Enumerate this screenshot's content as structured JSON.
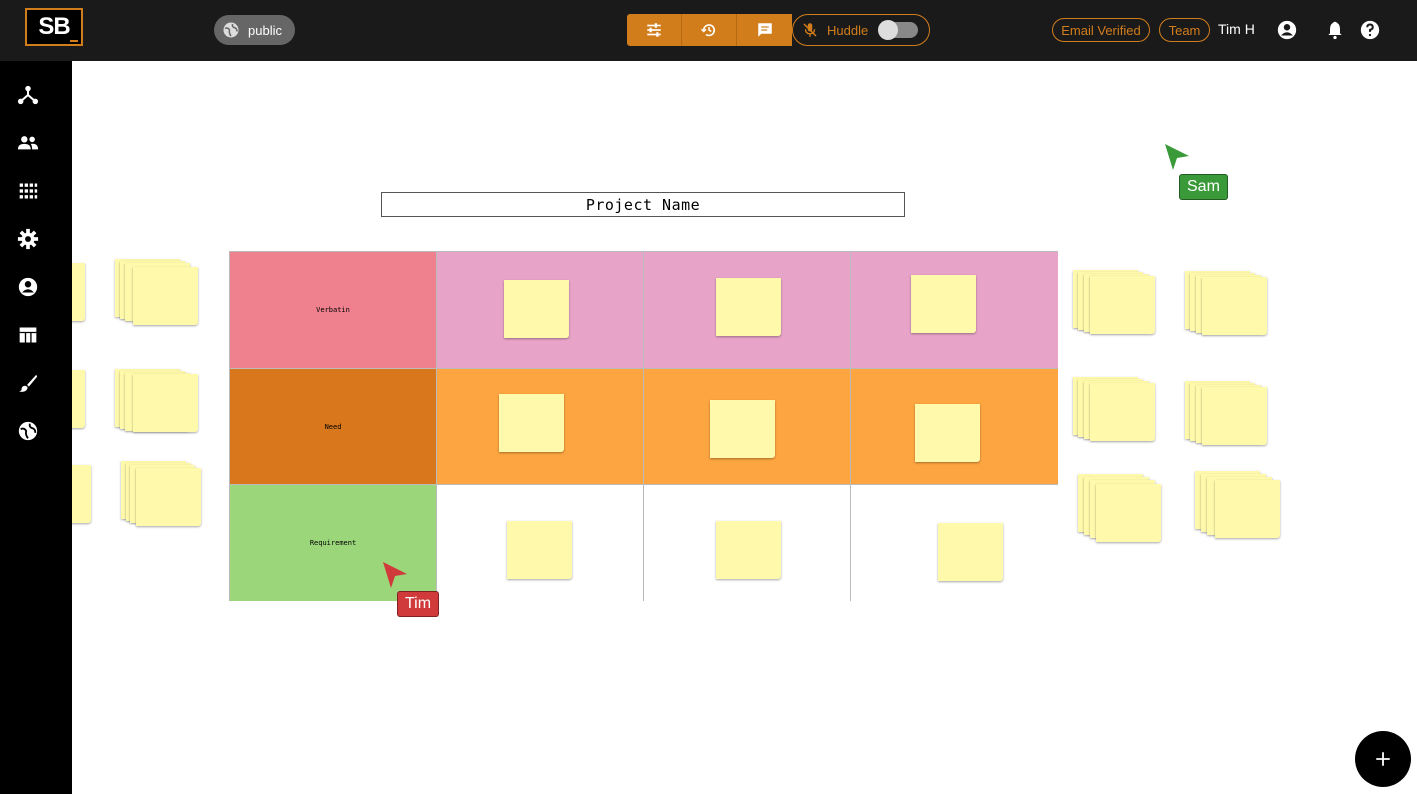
{
  "app": {
    "logo_text": "SB"
  },
  "header": {
    "visibility_label": "public",
    "toolbar": {
      "filter_icon": "sliders-icon",
      "history_icon": "history-icon",
      "chat_icon": "chat-icon"
    },
    "huddle": {
      "label": "Huddle",
      "enabled": false,
      "mic_icon": "mic-off-icon"
    },
    "email_verified_label": "Email Verified",
    "team_label": "Team",
    "user_name": "Tim H",
    "icons": [
      "account-icon",
      "bell-icon",
      "help-icon"
    ]
  },
  "sidebar": {
    "items": [
      "network-icon",
      "people-icon",
      "grid-apps-icon",
      "settings-icon",
      "account-icon",
      "table-icon",
      "brush-icon",
      "globe-icon"
    ]
  },
  "board": {
    "title": "Project Name",
    "rows": [
      {
        "label": "Verbatin",
        "label_color": "#ee818d",
        "cell_color": "#e8a4c8"
      },
      {
        "label": "Need",
        "label_color": "#d8771b",
        "cell_color": "#fda540"
      },
      {
        "label": "Requirement",
        "label_color": "#9cd67b",
        "cell_color": "#ffffff"
      }
    ],
    "note_color": "#fff9ab"
  },
  "collaborators": [
    {
      "name": "Sam",
      "color": "#3a9a3a"
    },
    {
      "name": "Tim",
      "color": "#d03a3a"
    }
  ],
  "colors": {
    "accent": "#d27d1b",
    "topbar": "#1a1a1a"
  }
}
